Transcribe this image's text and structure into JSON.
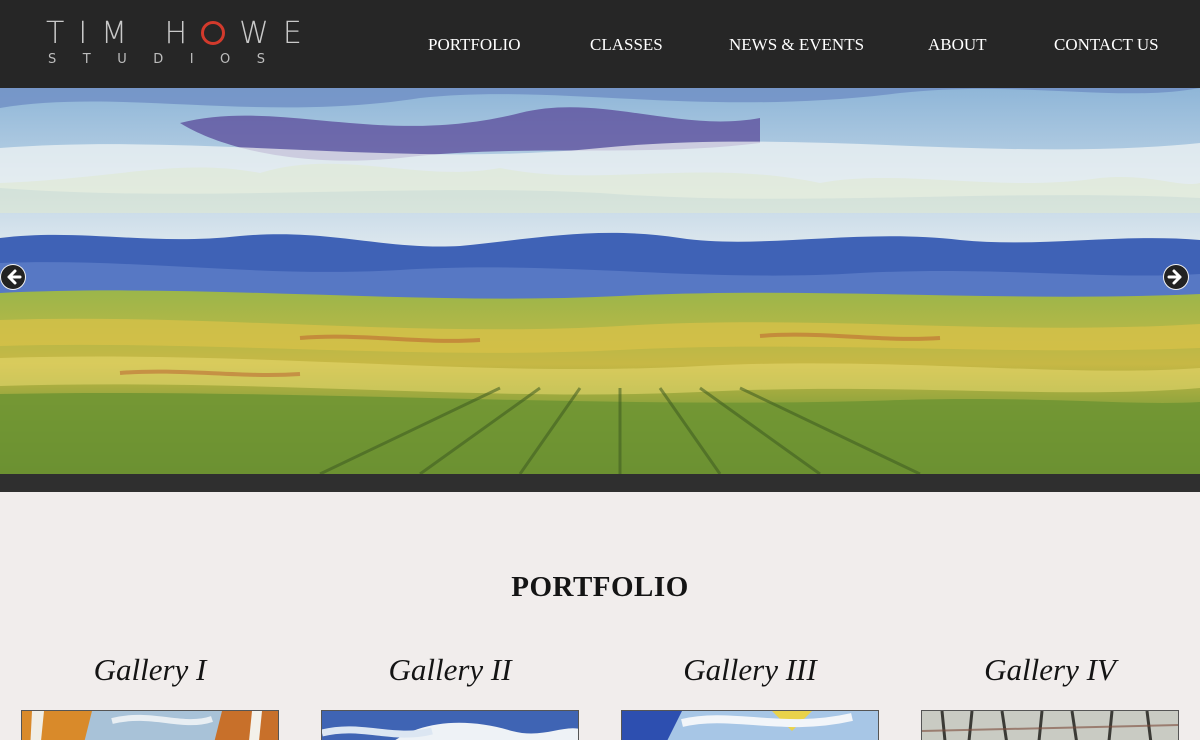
{
  "header": {
    "logo_text": "TIM HOWE",
    "logo_subtext": "STUDIOS",
    "nav": [
      {
        "label": "PORTFOLIO"
      },
      {
        "label": "CLASSES"
      },
      {
        "label": "NEWS & EVENTS"
      },
      {
        "label": "ABOUT"
      },
      {
        "label": "CONTACT US"
      }
    ]
  },
  "hero": {
    "icons": {
      "prev": "arrow-left-icon",
      "next": "arrow-right-icon"
    }
  },
  "portfolio": {
    "title": "PORTFOLIO",
    "galleries": [
      {
        "title": "Gallery I"
      },
      {
        "title": "Gallery II"
      },
      {
        "title": "Gallery III"
      },
      {
        "title": "Gallery IV"
      }
    ]
  },
  "colors": {
    "header_bg": "#262626",
    "logo_accent": "#d23a2c",
    "page_bg": "#f1edec"
  }
}
